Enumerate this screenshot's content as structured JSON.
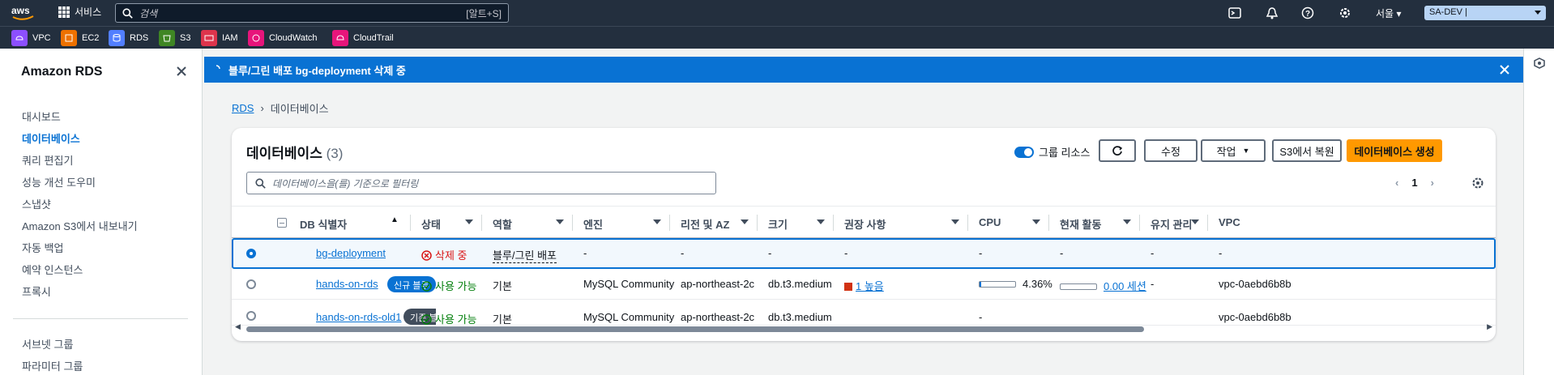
{
  "topbar": {
    "logo": "aws",
    "services_label": "서비스",
    "search_placeholder": "검색",
    "search_shortcut": "[알트+S]",
    "region": "서울",
    "account": "SA-DEV |",
    "icons": [
      "cloudshell-icon",
      "notifications-icon",
      "help-icon",
      "settings-icon"
    ]
  },
  "favorites": [
    {
      "label": "VPC",
      "color": "#8c4fff"
    },
    {
      "label": "EC2",
      "color": "#ed7100"
    },
    {
      "label": "RDS",
      "color": "#527fff"
    },
    {
      "label": "S3",
      "color": "#3f8624"
    },
    {
      "label": "IAM",
      "color": "#dd344c"
    },
    {
      "label": "CloudWatch",
      "color": "#e7157b"
    },
    {
      "label": "CloudTrail",
      "color": "#e7157b"
    }
  ],
  "sidenav": {
    "title": "Amazon RDS",
    "items": [
      {
        "label": "대시보드",
        "active": false
      },
      {
        "label": "데이터베이스",
        "active": true
      },
      {
        "label": "쿼리 편집기",
        "active": false
      },
      {
        "label": "성능 개선 도우미",
        "active": false
      },
      {
        "label": "스냅샷",
        "active": false
      },
      {
        "label": "Amazon S3에서 내보내기",
        "active": false
      },
      {
        "label": "자동 백업",
        "active": false
      },
      {
        "label": "예약 인스턴스",
        "active": false
      },
      {
        "label": "프록시",
        "active": false
      }
    ],
    "items2": [
      {
        "label": "서브넷 그룹"
      },
      {
        "label": "파라미터 그룹"
      }
    ]
  },
  "flash": {
    "message": "블루/그린 배포 bg-deployment 삭제 중"
  },
  "breadcrumb": {
    "root": "RDS",
    "current": "데이터베이스"
  },
  "panel": {
    "title": "데이터베이스",
    "count": "(3)",
    "group_toggle": "그룹 리소스",
    "modify": "수정",
    "actions": "작업",
    "restore_s3": "S3에서 복원",
    "create": "데이터베이스 생성",
    "filter_placeholder": "데이터베이스을(를) 기준으로 필터링",
    "page": "1"
  },
  "columns": [
    "DB 식별자",
    "상태",
    "역할",
    "엔진",
    "리전 및 AZ",
    "크기",
    "권장 사항",
    "CPU",
    "현재 활동",
    "유지 관리",
    "VPC"
  ],
  "rows": [
    {
      "id": "bg-deployment",
      "badge": "",
      "status": "삭제 중",
      "status_kind": "deleting",
      "role": "블루/그린 배포",
      "engine": "-",
      "region": "-",
      "size": "-",
      "recommend": "-",
      "cpu": "-",
      "cpu_pct": null,
      "activity": "-",
      "activity_pct": null,
      "maint": "-",
      "vpc": "-",
      "selected": true
    },
    {
      "id": "hands-on-rds",
      "badge": "신규 블루",
      "badge_color": "#0972d3",
      "status": "사용 가능",
      "status_kind": "ok",
      "role": "기본",
      "engine": "MySQL Community",
      "region": "ap-northeast-2c",
      "size": "db.t3.medium",
      "recommend": "1 높음",
      "cpu": "4.36%",
      "cpu_pct": 4.36,
      "activity": "0.00 세션",
      "activity_pct": 0,
      "maint": "-",
      "vpc": "vpc-0aebd6b8b",
      "selected": false
    },
    {
      "id": "hands-on-rds-old1",
      "badge": "기존 블",
      "badge_color": "#414d5c",
      "status": "사용 가능",
      "status_kind": "ok",
      "role": "기본",
      "engine": "MySQL Community",
      "region": "ap-northeast-2c",
      "size": "db.t3.medium",
      "recommend": "",
      "cpu": "-",
      "cpu_pct": null,
      "activity": "",
      "activity_pct": null,
      "maint": "",
      "vpc": "vpc-0aebd6b8b",
      "selected": false
    }
  ]
}
